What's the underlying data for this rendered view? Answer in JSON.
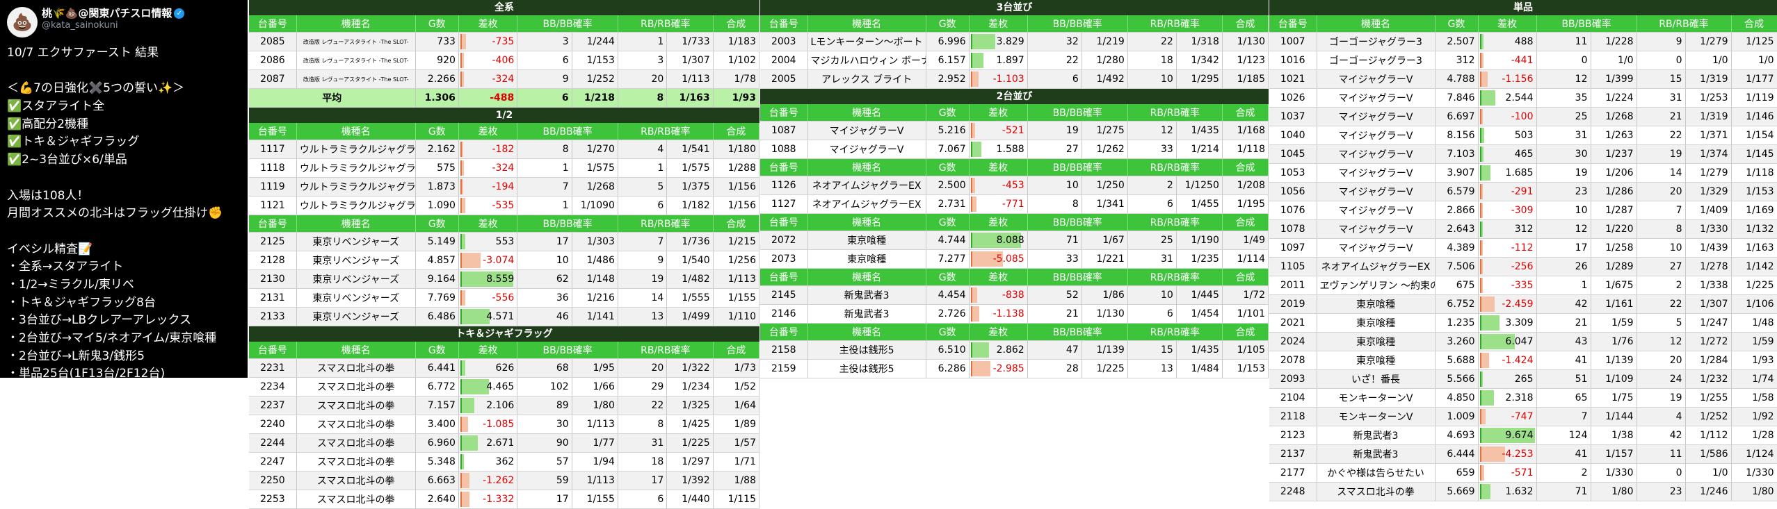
{
  "tweet": {
    "avatar_emoji": "💩",
    "display_name": "桃🌾💩@関東パチスロ情報",
    "verified_mark": "✓",
    "handle": "@kata_sainokuni",
    "lines": [
      "10/7 エクサファースト 結果",
      "",
      "＜💪7の日強化✖️5つの誓い✨＞",
      "✅スタアライト全",
      "✅高配分2機種",
      "✅トキ＆ジャギフラッグ",
      "✅2~3台並び×6/単品",
      "",
      "入場は108人！",
      "月間オススメの北斗はフラッグ仕掛け✊",
      "",
      "イベシル精査📝",
      "・全系→スタアライト",
      "・1/2→ミラクル/東リベ",
      "・トキ＆ジャギフラッグ8台",
      "・3台並び→LBクレアーアレックス",
      "・2台並び→マイ5/ネオアイム/東京喰種",
      "・2台並び→L新鬼3/銭形5",
      "・単品25台(1F13台/2F12台)"
    ]
  },
  "colors": {
    "header_green": "#3ec43a",
    "title_dark": "#1f3d1a",
    "negative_red": "#e00000",
    "avg_green": "#b9f2a7"
  },
  "headers": [
    "台番号",
    "機種名",
    "G数",
    "差枚",
    "BB/BB確率",
    "RB/RB確率",
    "合成"
  ],
  "sections": [
    {
      "id": "zenkei",
      "title": "全系",
      "max": 9000,
      "rows": [
        [
          "2085",
          "改造版 レヴューアスタライト -The SLOT-",
          "733",
          "-735",
          "3",
          "1/244",
          "1",
          "1/733",
          "1/183"
        ],
        [
          "2086",
          "改造版 レヴューアスタライト -The SLOT-",
          "920",
          "-406",
          "6",
          "1/153",
          "3",
          "1/307",
          "1/102"
        ],
        [
          "2087",
          "改造版 レヴューアスタライト -The SLOT-",
          "2.266",
          "-324",
          "9",
          "1/252",
          "20",
          "1/113",
          "1/78"
        ]
      ],
      "avg": [
        "平均",
        "1.306",
        "-488",
        "6",
        "1/218",
        "8",
        "1/163",
        "1/93"
      ]
    },
    {
      "id": "half-miracle",
      "title": "1/2",
      "max": 9000,
      "rows": [
        [
          "1117",
          "ウルトラミラクルジャグラー",
          "2.162",
          "-182",
          "8",
          "1/270",
          "4",
          "1/541",
          "1/180"
        ],
        [
          "1118",
          "ウルトラミラクルジャグラー",
          "575",
          "-324",
          "1",
          "1/575",
          "1",
          "1/575",
          "1/288"
        ],
        [
          "1119",
          "ウルトラミラクルジャグラー",
          "1.873",
          "-194",
          "7",
          "1/268",
          "5",
          "1/375",
          "1/156"
        ],
        [
          "1121",
          "ウルトラミラクルジャグラー",
          "1.090",
          "-535",
          "1",
          "1/1090",
          "6",
          "1/182",
          "1/156"
        ]
      ]
    },
    {
      "id": "half-tokyo",
      "title": "",
      "max": 9000,
      "rows": [
        [
          "2125",
          "東京リベンジャーズ",
          "5.149",
          "553",
          "17",
          "1/303",
          "7",
          "1/736",
          "1/215"
        ],
        [
          "2128",
          "東京リベンジャーズ",
          "4.857",
          "-3.074",
          "10",
          "1/486",
          "9",
          "1/540",
          "1/256"
        ],
        [
          "2130",
          "東京リベンジャーズ",
          "9.164",
          "8.559",
          "62",
          "1/148",
          "19",
          "1/482",
          "1/113"
        ],
        [
          "2131",
          "東京リベンジャーズ",
          "7.769",
          "-556",
          "36",
          "1/216",
          "14",
          "1/555",
          "1/155"
        ],
        [
          "2133",
          "東京リベンジャーズ",
          "6.486",
          "4.571",
          "46",
          "1/141",
          "13",
          "1/499",
          "1/110"
        ]
      ]
    },
    {
      "id": "tokijagi",
      "title": "トキ＆ジャギフラッグ",
      "max": 9000,
      "rows": [
        [
          "2231",
          "スマスロ北斗の拳",
          "6.441",
          "626",
          "68",
          "1/95",
          "20",
          "1/322",
          "1/73"
        ],
        [
          "2234",
          "スマスロ北斗の拳",
          "6.772",
          "4.465",
          "102",
          "1/66",
          "29",
          "1/234",
          "1/52"
        ],
        [
          "2237",
          "スマスロ北斗の拳",
          "7.157",
          "2.106",
          "89",
          "1/80",
          "22",
          "1/325",
          "1/64"
        ],
        [
          "2240",
          "スマスロ北斗の拳",
          "3.400",
          "-1.085",
          "30",
          "1/113",
          "8",
          "1/425",
          "1/89"
        ],
        [
          "2244",
          "スマスロ北斗の拳",
          "6.960",
          "2.671",
          "90",
          "1/77",
          "31",
          "1/225",
          "1/57"
        ],
        [
          "2247",
          "スマスロ北斗の拳",
          "5.348",
          "362",
          "57",
          "1/94",
          "18",
          "1/297",
          "1/71"
        ],
        [
          "2250",
          "スマスロ北斗の拳",
          "6.663",
          "-1.262",
          "59",
          "1/113",
          "17",
          "1/392",
          "1/88"
        ],
        [
          "2253",
          "スマスロ北斗の拳",
          "2.640",
          "-1.332",
          "17",
          "1/155",
          "6",
          "1/440",
          "1/115"
        ]
      ]
    },
    {
      "id": "three",
      "title": "3台並び",
      "max": 9000,
      "rows": [
        [
          "2003",
          "Lモンキーターン～ボートトリガー",
          "6.996",
          "3.829",
          "32",
          "1/219",
          "22",
          "1/318",
          "1/130"
        ],
        [
          "2004",
          "マジカルハロウィン ボーナストリガー",
          "6.157",
          "1.897",
          "22",
          "1/280",
          "18",
          "1/342",
          "1/123"
        ],
        [
          "2005",
          "アレックス ブライト",
          "2.952",
          "-1.103",
          "6",
          "1/492",
          "10",
          "1/295",
          "1/185"
        ]
      ]
    },
    {
      "id": "two-my",
      "title": "2台並び",
      "max": 9000,
      "rows": [
        [
          "1087",
          "マイジャグラーV",
          "5.216",
          "-521",
          "19",
          "1/275",
          "12",
          "1/435",
          "1/168"
        ],
        [
          "1088",
          "マイジャグラーV",
          "7.067",
          "1.588",
          "27",
          "1/262",
          "33",
          "1/214",
          "1/118"
        ]
      ]
    },
    {
      "id": "two-neo",
      "title": "",
      "max": 9000,
      "rows": [
        [
          "1126",
          "ネオアイムジャグラーEX",
          "2.500",
          "-453",
          "10",
          "1/250",
          "2",
          "1/1250",
          "1/208"
        ],
        [
          "1127",
          "ネオアイムジャグラーEX",
          "2.731",
          "-771",
          "8",
          "1/341",
          "6",
          "1/455",
          "1/195"
        ]
      ]
    },
    {
      "id": "two-ghoul",
      "title": "",
      "max": 9000,
      "rows": [
        [
          "2072",
          "東京喰種",
          "4.744",
          "8.088",
          "71",
          "1/67",
          "25",
          "1/190",
          "1/49"
        ],
        [
          "2073",
          "東京喰種",
          "7.277",
          "-5.085",
          "33",
          "1/221",
          "31",
          "1/235",
          "1/114"
        ]
      ]
    },
    {
      "id": "two-oni",
      "title": "",
      "max": 9000,
      "rows": [
        [
          "2145",
          "新鬼武者3",
          "4.454",
          "-838",
          "52",
          "1/86",
          "10",
          "1/445",
          "1/72"
        ],
        [
          "2146",
          "新鬼武者3",
          "2.726",
          "-1.138",
          "21",
          "1/130",
          "6",
          "1/454",
          "1/101"
        ]
      ]
    },
    {
      "id": "two-zeni",
      "title": "",
      "max": 9000,
      "rows": [
        [
          "2158",
          "主役は銭形5",
          "6.510",
          "2.862",
          "47",
          "1/139",
          "15",
          "1/435",
          "1/105"
        ],
        [
          "2159",
          "主役は銭形5",
          "6.286",
          "-2.985",
          "28",
          "1/225",
          "13",
          "1/484",
          "1/153"
        ]
      ]
    },
    {
      "id": "single",
      "title": "単品",
      "max": 9700,
      "rows": [
        [
          "1007",
          "ゴーゴージャグラー3",
          "2.507",
          "488",
          "11",
          "1/228",
          "9",
          "1/279",
          "1/125"
        ],
        [
          "1016",
          "ゴーゴージャグラー3",
          "312",
          "-441",
          "0",
          "1/0",
          "0",
          "1/0",
          "1/0"
        ],
        [
          "1021",
          "マイジャグラーV",
          "4.788",
          "-1.156",
          "12",
          "1/399",
          "15",
          "1/319",
          "1/177"
        ],
        [
          "1026",
          "マイジャグラーV",
          "7.846",
          "2.544",
          "35",
          "1/224",
          "31",
          "1/253",
          "1/119"
        ],
        [
          "1037",
          "マイジャグラーV",
          "6.697",
          "-100",
          "25",
          "1/268",
          "21",
          "1/319",
          "1/146"
        ],
        [
          "1040",
          "マイジャグラーV",
          "8.156",
          "503",
          "31",
          "1/263",
          "22",
          "1/371",
          "1/154"
        ],
        [
          "1045",
          "マイジャグラーV",
          "7.103",
          "465",
          "30",
          "1/237",
          "19",
          "1/374",
          "1/145"
        ],
        [
          "1053",
          "マイジャグラーV",
          "3.907",
          "1.685",
          "19",
          "1/206",
          "14",
          "1/279",
          "1/118"
        ],
        [
          "1056",
          "マイジャグラーV",
          "6.579",
          "-291",
          "23",
          "1/286",
          "20",
          "1/329",
          "1/153"
        ],
        [
          "1076",
          "マイジャグラーV",
          "2.866",
          "-309",
          "10",
          "1/287",
          "7",
          "1/409",
          "1/169"
        ],
        [
          "1078",
          "マイジャグラーV",
          "2.643",
          "312",
          "12",
          "1/220",
          "8",
          "1/330",
          "1/132"
        ],
        [
          "1097",
          "マイジャグラーV",
          "4.389",
          "-112",
          "17",
          "1/258",
          "10",
          "1/439",
          "1/163"
        ],
        [
          "1105",
          "ネオアイムジャグラーEX",
          "7.506",
          "-256",
          "26",
          "1/289",
          "27",
          "1/278",
          "1/142"
        ],
        [
          "2011",
          "ヱヴァンゲリヲン ～約束の扉～",
          "675",
          "-335",
          "1",
          "1/675",
          "2",
          "1/338",
          "1/225"
        ],
        [
          "2019",
          "東京喰種",
          "6.752",
          "-2.459",
          "42",
          "1/161",
          "22",
          "1/307",
          "1/106"
        ],
        [
          "2021",
          "東京喰種",
          "1.235",
          "3.309",
          "21",
          "1/59",
          "5",
          "1/247",
          "1/48"
        ],
        [
          "2024",
          "東京喰種",
          "3.260",
          "6.047",
          "43",
          "1/76",
          "12",
          "1/272",
          "1/59"
        ],
        [
          "2078",
          "東京喰種",
          "5.688",
          "-1.424",
          "41",
          "1/139",
          "20",
          "1/284",
          "1/93"
        ],
        [
          "2093",
          "いざ！番長",
          "5.566",
          "265",
          "51",
          "1/109",
          "24",
          "1/232",
          "1/74"
        ],
        [
          "2104",
          "モンキーターンV",
          "4.850",
          "2.318",
          "65",
          "1/75",
          "19",
          "1/255",
          "1/58"
        ],
        [
          "2118",
          "モンキーターンV",
          "1.009",
          "-747",
          "7",
          "1/144",
          "4",
          "1/252",
          "1/92"
        ],
        [
          "2123",
          "新鬼武者3",
          "4.693",
          "9.674",
          "124",
          "1/38",
          "42",
          "1/112",
          "1/28"
        ],
        [
          "2137",
          "新鬼武者3",
          "6.444",
          "-4.253",
          "41",
          "1/157",
          "11",
          "1/586",
          "1/124"
        ],
        [
          "2177",
          "かぐや様は告らせたい",
          "659",
          "-571",
          "2",
          "1/330",
          "0",
          "1/0",
          "1/330"
        ],
        [
          "2248",
          "スマスロ北斗の拳",
          "5.669",
          "1.632",
          "71",
          "1/80",
          "23",
          "1/246",
          "1/80"
        ]
      ]
    }
  ]
}
